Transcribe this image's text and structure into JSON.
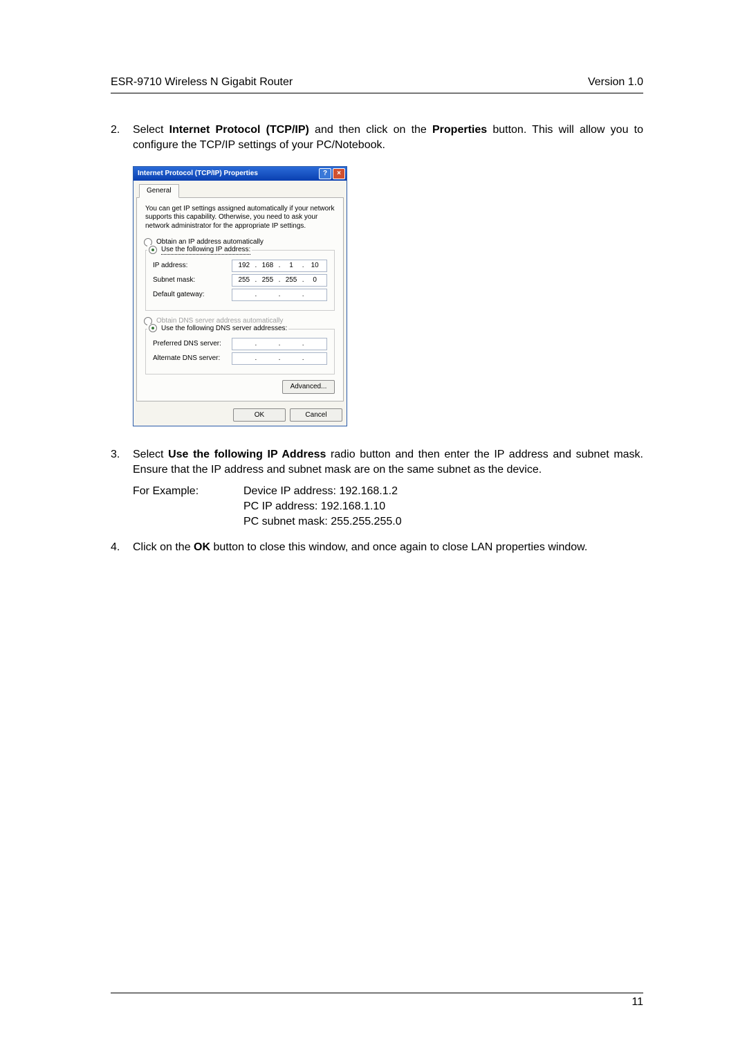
{
  "header": {
    "left": "ESR-9710 Wireless N Gigabit Router",
    "right": "Version 1.0"
  },
  "step2": {
    "num": "2.",
    "pre": "Select ",
    "bold1": "Internet Protocol (TCP/IP)",
    "mid": " and then click on the ",
    "bold2": "Properties",
    "post": " button. This will allow you to configure the TCP/IP settings of your PC/Notebook."
  },
  "dialog": {
    "title": "Internet Protocol (TCP/IP) Properties",
    "tab": "General",
    "desc": "You can get IP settings assigned automatically if your network supports this capability. Otherwise, you need to ask your network administrator for the appropriate IP settings.",
    "radio_auto_ip": "Obtain an IP address automatically",
    "radio_use_ip": "Use the following IP address:",
    "ip_label": "IP address:",
    "ip": {
      "a": "192",
      "b": "168",
      "c": "1",
      "d": "10"
    },
    "subnet_label": "Subnet mask:",
    "subnet": {
      "a": "255",
      "b": "255",
      "c": "255",
      "d": "0"
    },
    "gateway_label": "Default gateway:",
    "radio_auto_dns": "Obtain DNS server address automatically",
    "radio_use_dns": "Use the following DNS server addresses:",
    "pref_dns_label": "Preferred DNS server:",
    "alt_dns_label": "Alternate DNS server:",
    "advanced": "Advanced...",
    "ok": "OK",
    "cancel": "Cancel"
  },
  "step3": {
    "num": "3.",
    "pre": "Select ",
    "bold1": "Use the following IP Address",
    "post": " radio button and then enter the IP address and subnet mask. Ensure that the IP address and subnet mask are on the same subnet as the device.",
    "example_label": "For Example:",
    "device_ip": "Device IP address: 192.168.1.2",
    "pc_ip": "PC IP address: 192.168.1.10",
    "pc_mask": "PC subnet mask: 255.255.255.0"
  },
  "step4": {
    "num": "4.",
    "pre": "Click on the ",
    "bold1": "OK",
    "post": " button to close this window, and once again to close LAN properties window."
  },
  "footer": {
    "page": "11"
  }
}
